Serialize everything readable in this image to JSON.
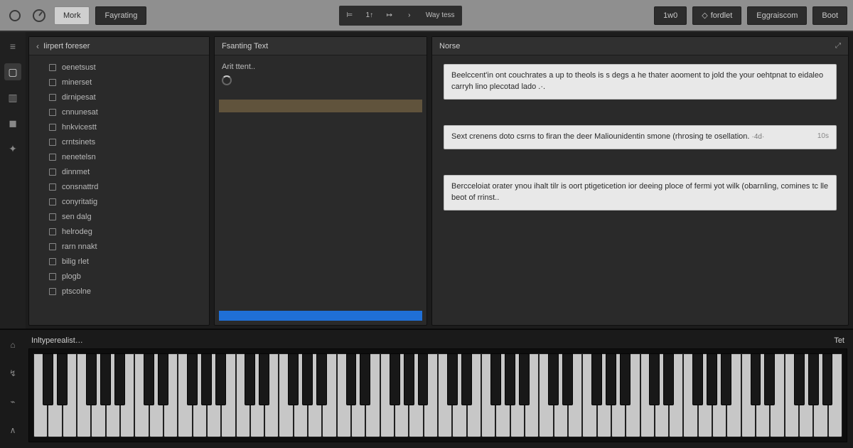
{
  "toolbar": {
    "btn_a_label": "Mork",
    "btn_b_label": "Fayrating",
    "transport": {
      "item1": "⊨",
      "item2": "1↑",
      "item3": "↦",
      "item4": "›",
      "item5_label": "Way tess"
    },
    "right": {
      "btn1": "1w0",
      "btn2_icon": "◇",
      "btn2_label": "fordlet",
      "btn3": "Eggraiscom",
      "btn4": "Boot"
    }
  },
  "rail": {
    "i1": "≡",
    "i2": "▢",
    "i3": "▥",
    "i4": "◼",
    "i5": "✦"
  },
  "browser": {
    "title": "Iirpert foreser",
    "items": [
      "oenetsust",
      "minerset",
      "dirnipesat",
      "cnnunesat",
      "hnkvicestt",
      "crntsinets",
      "nenetelsn",
      "dinnmet",
      "consnattrd",
      "conyritatig",
      "sen dalg",
      "helrodeg",
      "rarn nnakt",
      "bilig rlet",
      "plogb",
      "ptscolne"
    ]
  },
  "textp": {
    "title": "Fsanting Text",
    "sub": "Arit ttent.."
  },
  "notes": {
    "title": "Norse",
    "cards": [
      {
        "text": "Beelccent'in ont couchrates a up to theols is s degs a he thater aooment to jold the your oehtpnat to eidaleo carryh lino plecotad lado .·.",
        "tag": "",
        "meta": ""
      },
      {
        "text": "Sext crenens doto csrns to  firan the deer Maliounidentin smone (rhrosing te osellation.",
        "tag": "10s",
        "meta": "·4d·"
      },
      {
        "text": "Bercceloiat orater ynou ihalt tilr is oort ptigeticetion ior deeing ploce of fermi yot wilk (obarnling, comines tc lle beot of rrinst..",
        "tag": "",
        "meta": ""
      }
    ]
  },
  "dock": {
    "title": "Inltyperealist…",
    "right_label": "Tet",
    "rail": {
      "i1": "⌂",
      "i2": "↯",
      "i3": "⌁",
      "i4": "∧"
    },
    "octaves": 8
  }
}
